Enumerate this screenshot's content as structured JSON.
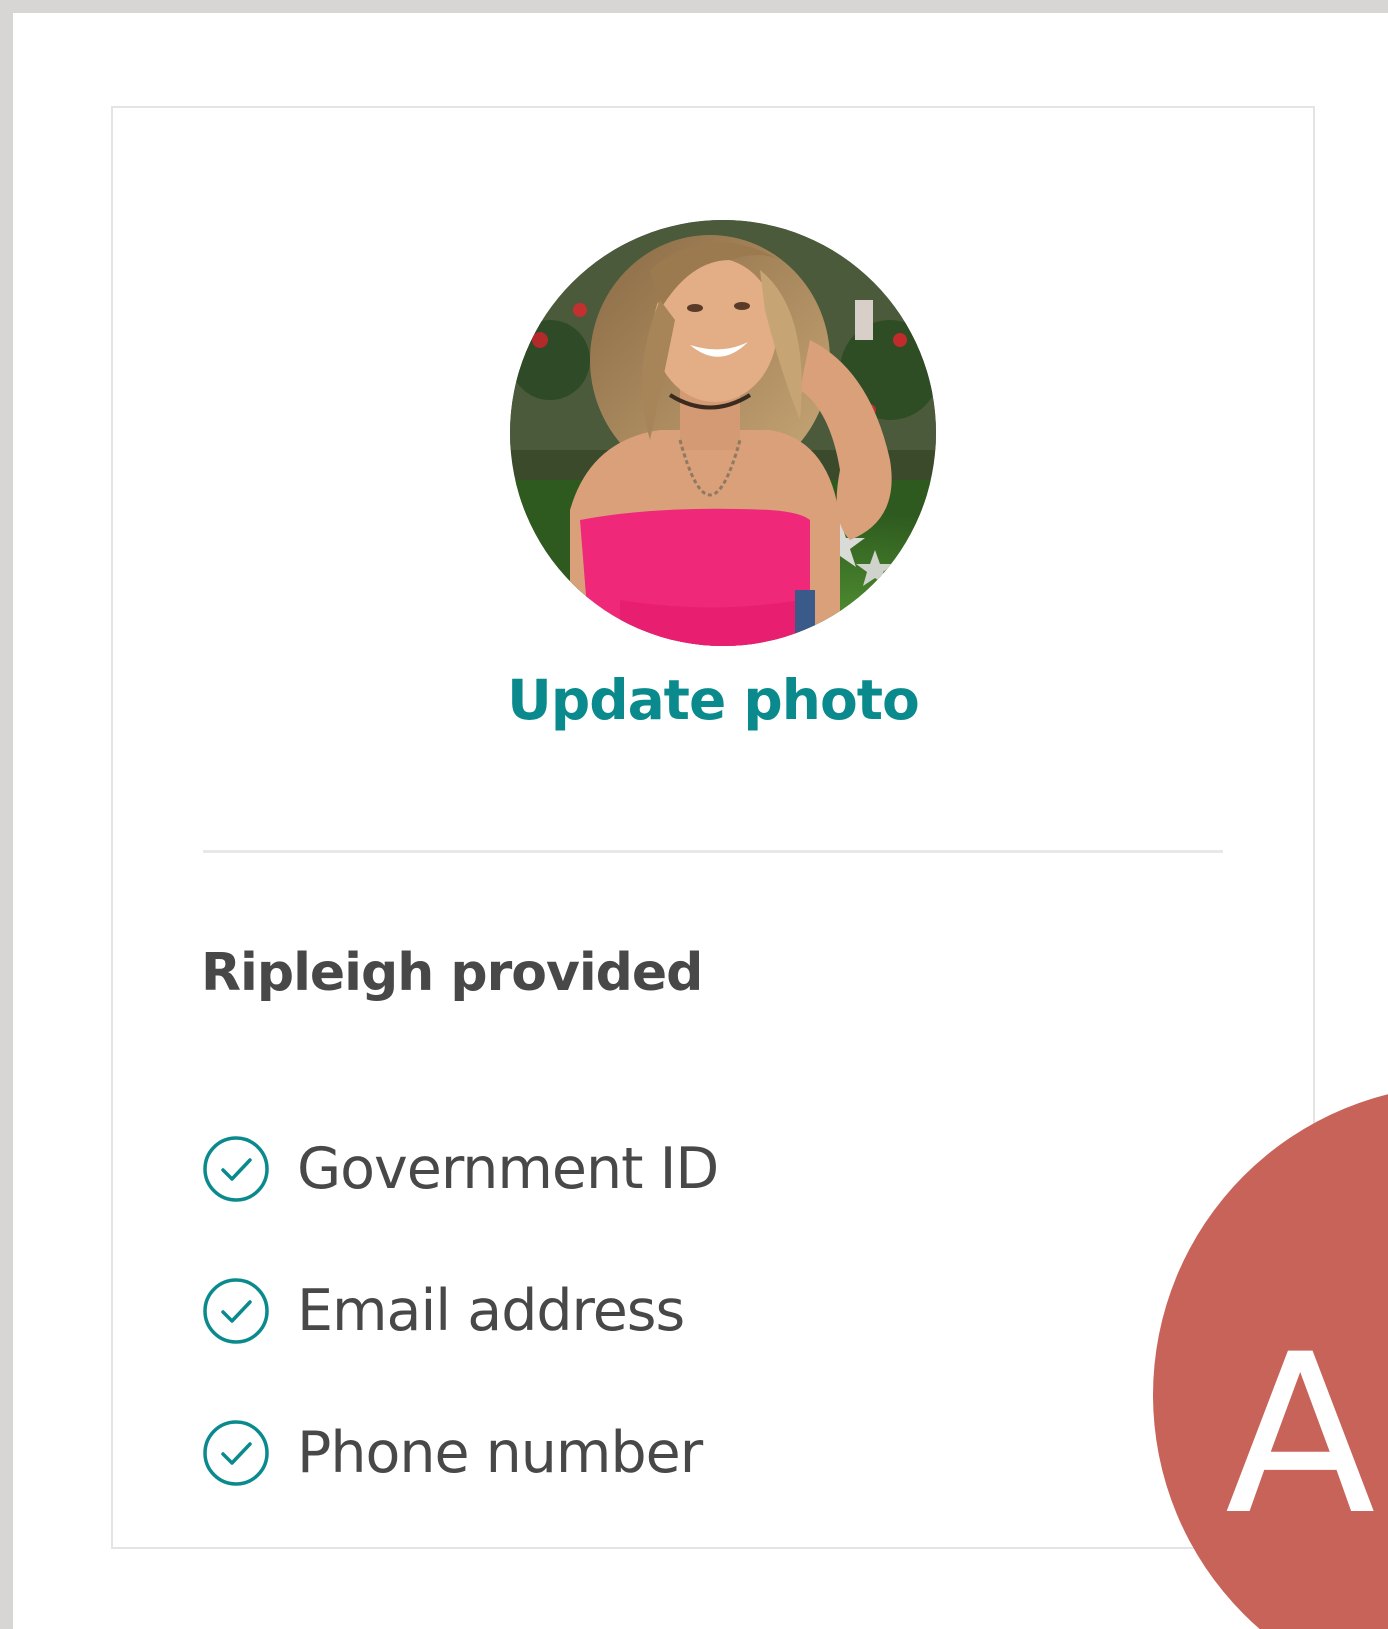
{
  "profile": {
    "avatar_icon": "profile-photo",
    "update_photo_label": "Update photo"
  },
  "verification": {
    "heading": "Ripleigh provided",
    "check_icon": "check-circle-icon",
    "items": [
      {
        "label": "Government ID"
      },
      {
        "label": "Email address"
      },
      {
        "label": "Phone number"
      }
    ]
  },
  "badge": {
    "text": "Ai"
  },
  "colors": {
    "accent": "#0a8a8d",
    "text": "#484848",
    "badge": "#c8635a",
    "page_bg": "#d8d6d5"
  }
}
